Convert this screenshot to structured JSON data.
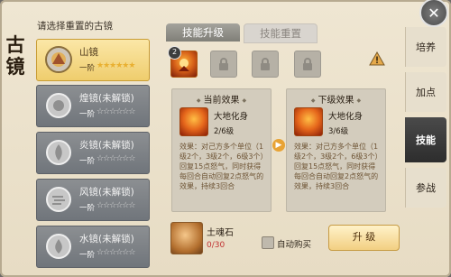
{
  "header": {
    "vertical_title": "古镜",
    "prompt": "请选择重置的古镜"
  },
  "mirrors": [
    {
      "name": "山镜",
      "level": "一阶",
      "stars": "★★★★★★",
      "icon": "mountain-mirror-icon"
    },
    {
      "name": "煌镜(未解锁)",
      "level": "一阶",
      "stars": "☆☆☆☆☆☆",
      "icon": "huang-mirror-icon"
    },
    {
      "name": "炎镜(未解锁)",
      "level": "一阶",
      "stars": "☆☆☆☆☆☆",
      "icon": "flame-mirror-icon"
    },
    {
      "name": "风镜(未解锁)",
      "level": "一阶",
      "stars": "☆☆☆☆☆☆",
      "icon": "wind-mirror-icon"
    },
    {
      "name": "水镜(未解锁)",
      "level": "一阶",
      "stars": "☆☆☆☆☆☆",
      "icon": "water-mirror-icon"
    }
  ],
  "top_tabs": [
    {
      "label": "技能升级"
    },
    {
      "label": "技能重置"
    }
  ],
  "side_tabs": [
    {
      "label": "培养"
    },
    {
      "label": "加点"
    },
    {
      "label": "技能"
    },
    {
      "label": "参战"
    }
  ],
  "skill_slots": {
    "badge": "2"
  },
  "current": {
    "header": "当前效果",
    "name": "大地化身",
    "level": "2/6级",
    "desc": "效果：对己方多个单位（1级2个，3级2个，6级3个）回复15点怒气，同时获得每回合自动回复2点怒气的效果，持续3回合"
  },
  "next": {
    "header": "下级效果",
    "name": "大地化身",
    "level": "3/6级",
    "desc": "效果：对己方多个单位（1级2个，3级2个，6级3个）回复15点怒气，同时获得每回合自动回复2点怒气的效果，持续3回合"
  },
  "material": {
    "name": "土魂石",
    "count": "0/30"
  },
  "auto_buy": {
    "label": "自动购买"
  },
  "upgrade": {
    "label": "升 级"
  },
  "colors": {
    "accent_gold": "#efcd6d",
    "count_red": "#c13232",
    "tab_active": "#2d2d2d"
  }
}
